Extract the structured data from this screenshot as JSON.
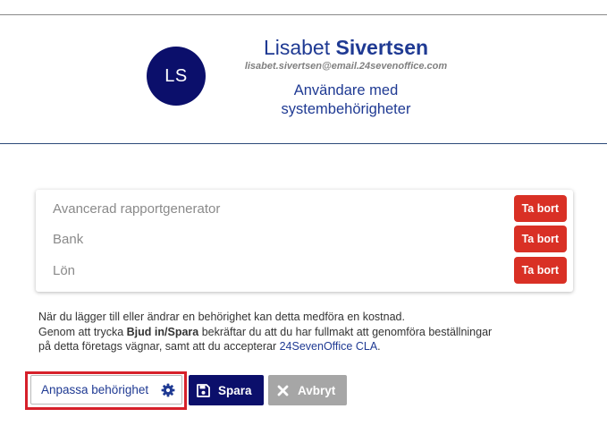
{
  "user": {
    "initials": "LS",
    "first_name": "Lisabet",
    "last_name": "Sivertsen",
    "email": "lisabet.sivertsen@email.24sevenoffice.com",
    "role_line1": "Användare med",
    "role_line2": "systembehörigheter"
  },
  "permissions": [
    {
      "label": "Avancerad rapportgenerator",
      "remove_label": "Ta bort"
    },
    {
      "label": "Bank",
      "remove_label": "Ta bort"
    },
    {
      "label": "Lön",
      "remove_label": "Ta bort"
    }
  ],
  "notice": {
    "line1": "När du lägger till eller ändrar en behörighet kan detta medföra en kostnad.",
    "line2_pre": "Genom att trycka ",
    "line2_bold": "Bjud in/Spara",
    "line2_post": " bekräftar du att du har fullmakt att genomföra beställningar",
    "line3_pre": "på detta företags vägnar, samt att du accepterar ",
    "line3_link": "24SevenOffice CLA",
    "line3_post": "."
  },
  "actions": {
    "customize_label": "Anpassa behörighet",
    "save_label": "Spara",
    "cancel_label": "Avbryt"
  },
  "colors": {
    "primary": "#0b0f6b",
    "link": "#1f3a93",
    "danger": "#d93025",
    "muted_button": "#a6a6a6",
    "highlight": "#d6202a"
  },
  "icons": {
    "customize": "gear-icon",
    "save": "floppy-disk-icon",
    "cancel": "x-icon"
  }
}
